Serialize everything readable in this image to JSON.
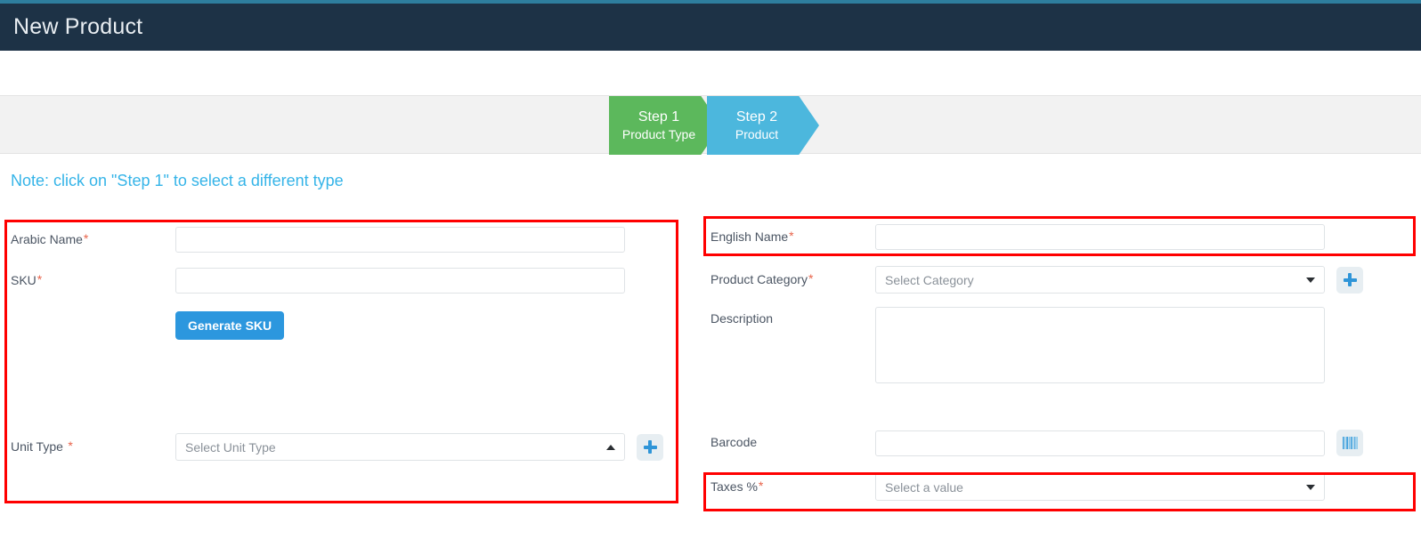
{
  "header": {
    "title": "New Product",
    "bg_color": "#1d3246",
    "strip_color": "#2e7e9e"
  },
  "steps": [
    {
      "title": "Step 1",
      "subtitle": "Product Type",
      "color": "#5cb85c",
      "state": "completed"
    },
    {
      "title": "Step 2",
      "subtitle": "Product",
      "color": "#4cb7dd",
      "state": "active"
    }
  ],
  "note": {
    "text": "Note: click on \"Step 1\" to select a different type",
    "color": "#35b4e8"
  },
  "highlight": {
    "color": "#ff0000"
  },
  "form": {
    "left": {
      "arabic_name": {
        "label": "Arabic Name",
        "required": "*",
        "value": "",
        "placeholder": ""
      },
      "sku": {
        "label": "SKU",
        "required": "*",
        "value": "",
        "placeholder": ""
      },
      "generate_sku_button": {
        "label": "Generate SKU"
      },
      "unit_type": {
        "label": "Unit Type",
        "required": "*",
        "value": "Select Unit Type",
        "caret": "caret-up"
      },
      "unit_type_add": {
        "icon": "plus-icon"
      }
    },
    "right": {
      "english_name": {
        "label": "English Name",
        "required": "*",
        "value": "",
        "placeholder": ""
      },
      "product_category": {
        "label": "Product Category",
        "required": "*",
        "value": "Select Category",
        "caret": "caret-down"
      },
      "product_category_add": {
        "icon": "plus-icon"
      },
      "description": {
        "label": "Description",
        "required": "",
        "value": "",
        "placeholder": ""
      },
      "barcode": {
        "label": "Barcode",
        "required": "",
        "value": "",
        "placeholder": ""
      },
      "barcode_scan": {
        "icon": "barcode-icon"
      },
      "taxes": {
        "label": "Taxes %",
        "required": "*",
        "value": "Select a value",
        "caret": "caret-down"
      }
    }
  }
}
